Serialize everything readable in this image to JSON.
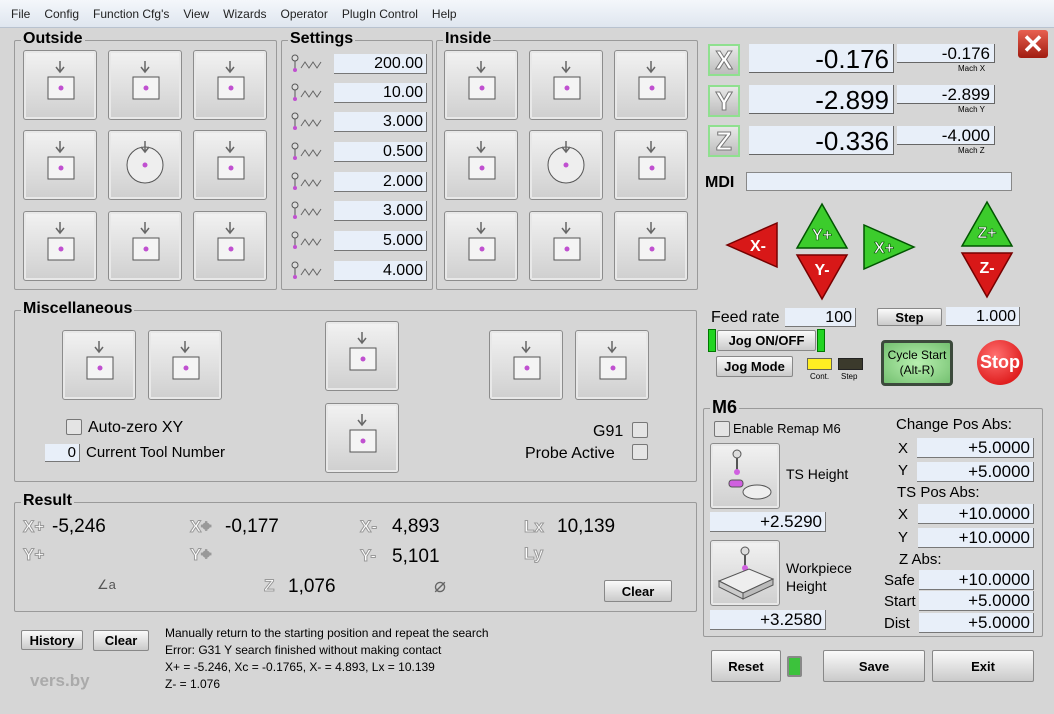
{
  "menu": [
    "File",
    "Config",
    "Function Cfg's",
    "View",
    "Wizards",
    "Operator",
    "PlugIn Control",
    "Help"
  ],
  "outside": {
    "title": "Outside"
  },
  "settings": {
    "title": "Settings",
    "values": [
      "200.00",
      "10.00",
      "3.000",
      "0.500",
      "2.000",
      "3.000",
      "5.000",
      "4.000"
    ]
  },
  "inside": {
    "title": "Inside"
  },
  "dro": {
    "axes": [
      {
        "btn": "X",
        "value": "-0.176",
        "mach": "-0.176",
        "mach_label": "Mach X"
      },
      {
        "btn": "Y",
        "value": "-2.899",
        "mach": "-2.899",
        "mach_label": "Mach Y"
      },
      {
        "btn": "Z",
        "value": "-0.336",
        "mach": "-4.000",
        "mach_label": "Mach Z"
      }
    ]
  },
  "mdi": {
    "label": "MDI",
    "value": ""
  },
  "jog": {
    "x_minus": "X-",
    "x_plus": "X+",
    "y_plus": "Y+",
    "y_minus": "Y-",
    "z_plus": "Z+",
    "z_minus": "Z-"
  },
  "feed": {
    "label": "Feed rate",
    "value": "100",
    "step_label": "Step",
    "step_value": "1.000",
    "jog_onoff": "Jog ON/OFF",
    "jog_mode": "Jog Mode",
    "cont": "Cont.",
    "step": "Step",
    "cycle_start": "Cycle Start",
    "cycle_key": "(Alt-R)",
    "stop": "Stop"
  },
  "misc": {
    "title": "Miscellaneous",
    "auto_zero": "Auto-zero XY",
    "tool_number": "0",
    "tool_label": "Current Tool Number",
    "g91": "G91",
    "probe_active": "Probe Active"
  },
  "result": {
    "title": "Result",
    "xplus": "-5,246",
    "xc": "-0,177",
    "xminus": "4,893",
    "lx": "10,139",
    "yplus": "",
    "yc": "",
    "yminus": "5,101",
    "ly": "",
    "z": "1,076",
    "clear": "Clear",
    "glyphs": {
      "xplus": "X+",
      "xc": "X⌖",
      "xminus": "X-",
      "lx": "Lx",
      "yplus": "Y+",
      "yc": "Y⌖",
      "yminus": "Y-",
      "ly": "Ly",
      "angle": "∠a",
      "z": "Z",
      "diameter": "⌀"
    }
  },
  "log": {
    "history": "History",
    "clear": "Clear",
    "lines": [
      "Manually return to the starting position and repeat the search",
      "Error: G31 Y search finished without making contact",
      "X+ = -5.246, Xc = -0.1765, X- = 4.893, Lx = 10.139",
      "Z- = 1.076"
    ],
    "logo": "vers.by"
  },
  "m6": {
    "title": "M6",
    "enable": "Enable Remap M6",
    "ts_height": "TS Height",
    "ts_value": "+2.5290",
    "wp_height": "Workpiece",
    "wp_height2": "Height",
    "wp_value": "+3.2580",
    "change_pos": "Change Pos Abs:",
    "cx": "+5.0000",
    "cy": "+5.0000",
    "ts_pos": "TS Pos Abs:",
    "tx": "+10.0000",
    "ty": "+10.0000",
    "z_abs": "Z Abs:",
    "safe_label": "Safe",
    "safe": "+10.0000",
    "start_label": "Start",
    "start": "+5.0000",
    "dist_label": "Dist",
    "dist": "+5.0000",
    "x": "X",
    "y": "Y"
  },
  "footer": {
    "reset": "Reset",
    "save": "Save",
    "exit": "Exit"
  }
}
